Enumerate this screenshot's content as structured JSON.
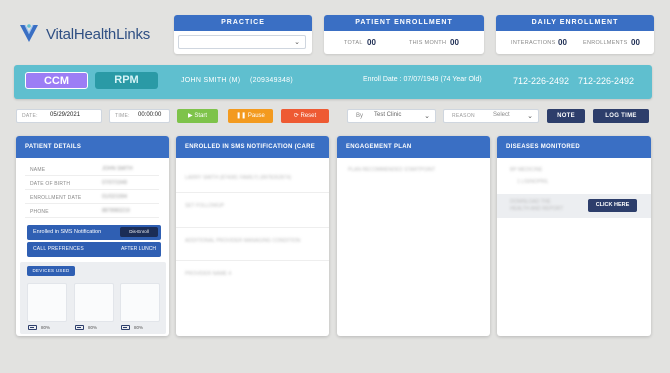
{
  "brand": {
    "name": "VitalHealthLinks",
    "logo_icon": "vital-health-logo-icon",
    "accent": "#3a6fc4"
  },
  "practice": {
    "title": "PRACTICE",
    "selected": ""
  },
  "patient_enrollment": {
    "title": "PATIENT ENROLLMENT",
    "total_label": "TOTAL",
    "total": "00",
    "month_label": "THIS MONTH",
    "month": "00"
  },
  "daily_enrollment": {
    "title": "DAILY ENROLLMENT",
    "interactions_label": "INTERACTIONS",
    "interactions": "00",
    "enrollments_label": "ENROLLMENTS",
    "enrollments": "00"
  },
  "patient_bar": {
    "ccm": "CCM",
    "rpm": "RPM",
    "name": "JOHN SMITH (M)",
    "id": "(209349348)",
    "enroll": "Enroll Date : 07/07/1949 (74 Year Old)",
    "phone1": "712-226-2492",
    "phone2": "712-226-2492"
  },
  "controls": {
    "date_label": "DATE:",
    "date": "05/29/2021",
    "time_label": "TIME:",
    "time": "00:00:00",
    "start": "Start",
    "pause": "Pause",
    "reset": "Reset",
    "by_label": "By",
    "by_value": "Test Clinic",
    "reason_label": "REASON",
    "reason_value": "Select",
    "note": "NOTE",
    "log_time": "LOG TIME"
  },
  "patient_details": {
    "title": "PATIENT DETAILS",
    "rows": [
      {
        "label": "NAME",
        "value": "JOHN SMITH"
      },
      {
        "label": "DATE OF BIRTH",
        "value": "07/07/1949"
      },
      {
        "label": "ENROLLMENT DATE",
        "value": "01/02/1994"
      },
      {
        "label": "PHONE",
        "value": "8878983219"
      }
    ],
    "sms_label": "Enrolled in SMS Notification",
    "sms_btn": "Dis-Enroll",
    "call_label": "CALL PREFRENCES",
    "call_value": "AFTER LUNCH",
    "devices_label": "DEVICES USED",
    "devices": [
      {
        "battery": "80%"
      },
      {
        "battery": "80%"
      },
      {
        "battery": "80%"
      }
    ]
  },
  "sms_panel": {
    "title": "ENROLLED IN SMS NOTIFICATION (CARE TEAM)",
    "items": [
      "LARRY SMITH (874081 FAMILY) (8978262874)",
      "SET FOLLOWUP",
      "ADDITIONAL PROVIDER MANAGING CONDITION",
      "PROVIDER NAME 4"
    ]
  },
  "engagement": {
    "title": "ENGAGEMENT PLAN",
    "line": "PLAN RECOMMENDED STARTPOINT"
  },
  "diseases": {
    "title": "DISEASES MONITORED",
    "line1": "BP MEDICINE",
    "line2": "1 LISINOPRIL",
    "cta_text": "DOWNLOAD THE HEALTH AND REPORT",
    "cta_btn": "CLICK HERE"
  }
}
